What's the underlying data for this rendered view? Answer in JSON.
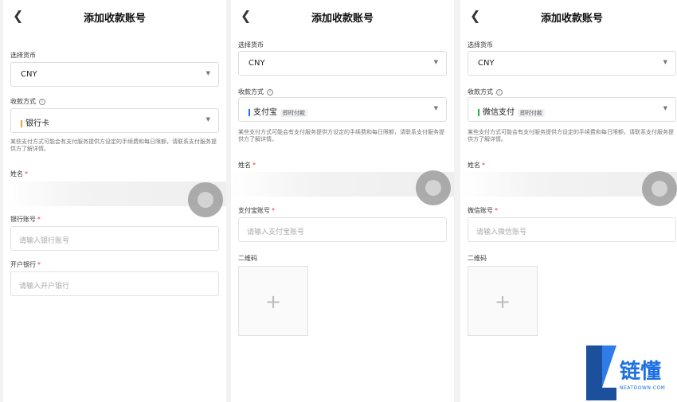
{
  "screen_title": "添加收款账号",
  "currency_label": "选择货币",
  "currency_value": "CNY",
  "method_label": "收款方式",
  "notice": "某些支付方式可能会有支付服务提供方设定的手续费和每日限额，请联系支付服务提供方了解详情。",
  "name_label": "姓名",
  "panels": [
    {
      "method": {
        "name": "银行卡",
        "tag": "",
        "color": "#f0a030"
      },
      "field1": {
        "label": "银行账号",
        "placeholder": "请输入银行账号"
      },
      "field2": {
        "label": "开户银行",
        "placeholder": "请输入开户银行"
      }
    },
    {
      "method": {
        "name": "支付宝",
        "tag": "即时付款",
        "color": "#1677ff"
      },
      "field1": {
        "label": "支付宝账号",
        "placeholder": "请输入支付宝账号"
      },
      "qr_label": "二维码"
    },
    {
      "method": {
        "name": "微信支付",
        "tag": "即时付款",
        "color": "#22b14c"
      },
      "field1": {
        "label": "微信账号",
        "placeholder": "请输入微信账号"
      },
      "qr_label": "二维码"
    }
  ],
  "watermark": {
    "brand": "链懂",
    "site": "NEATDOWN.COM"
  }
}
